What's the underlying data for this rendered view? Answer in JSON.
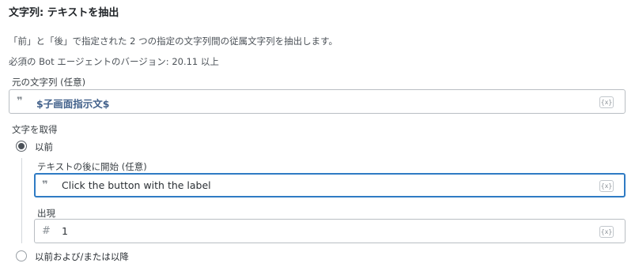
{
  "header": {
    "title": "文字列: テキストを抽出",
    "description": "「前」と「後」で指定された 2 つの指定の文字列間の従属文字列を抽出します。",
    "requirement": "必須の Bot エージェントのバージョン: 20.11 以上"
  },
  "source_field": {
    "label": "元の文字列 (任意)",
    "icon": "quote-icon",
    "value": "$子画面指示文$",
    "var_button": "{x}"
  },
  "get_text": {
    "label": "文字を取得",
    "options": [
      {
        "label": "以前",
        "checked": true
      },
      {
        "label": "以前および/または以降",
        "checked": false
      }
    ]
  },
  "after_field": {
    "label": "テキストの後に開始 (任意)",
    "icon": "quote-icon",
    "value": "Click the button with the label",
    "var_button": "{x}"
  },
  "occurrence_field": {
    "label": "出現",
    "icon": "hash-icon",
    "value": "1",
    "var_button": "{x}"
  }
}
